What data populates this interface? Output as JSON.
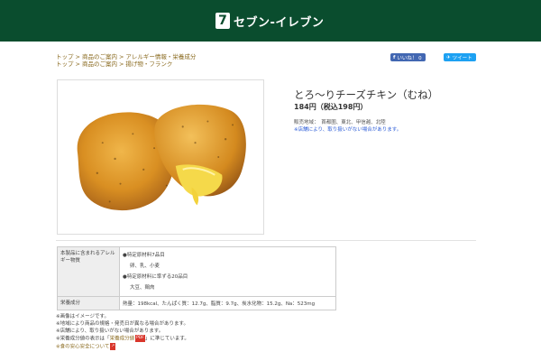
{
  "header": {
    "logo_mark": "7",
    "logo_text": "セブン‐イレブン"
  },
  "breadcrumbs": {
    "row1": [
      "トップ",
      "商品のご案内",
      "アレルギー情報・栄養成分"
    ],
    "row2": [
      "トップ",
      "商品のご案内",
      "揚げ物・フランク"
    ],
    "separator": ">"
  },
  "social": {
    "facebook_label": "いいね！ 0",
    "twitter_label": "ツイート"
  },
  "product": {
    "title": "とろ～りチーズチキン（むね）",
    "price": "184円（税込198円）",
    "area_text": "販売地域：　首都圏、東北、甲信越、北陸",
    "area_note": "※店舗により、取り扱いがない場合があります。"
  },
  "allergy": {
    "header": "本製品に含まれるアレルギー物質",
    "line1": "●特定原材料7品目",
    "line2": "卵、乳、小麦",
    "line3": "●特定原材料に準ずる20品目",
    "line4": "大豆、鶏肉"
  },
  "nutrition": {
    "header": "栄養成分",
    "value": "熱量：198kcal、たんぱく質：12.7g、脂質：9.7g、炭水化物：15.2g、Na：523mg"
  },
  "notes": {
    "line1": "※画像はイメージです。",
    "line2": "※地域により商品の規格・発売日が異なる場合があります。",
    "line3": "※店舗により、取り扱いがない場合があります。",
    "line4_prefix": "※栄養成分値の表示は「",
    "line4_link": "栄養成分値",
    "line4_badge": "PDF",
    "line4_suffix": "」に準じています。",
    "line5_link": "※食の安心安全について"
  },
  "colors": {
    "header_bg": "#0a4d2e",
    "link": "#8a6a1f",
    "note_blue": "#2a5bd7"
  }
}
